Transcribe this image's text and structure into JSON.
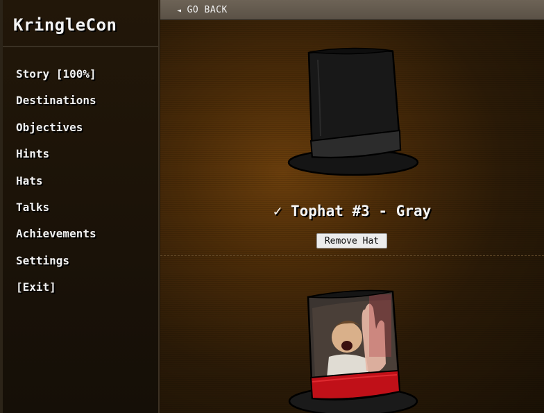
{
  "sidebar": {
    "logo": "KringleCon",
    "items": [
      {
        "label": "Story [100%]"
      },
      {
        "label": "Destinations"
      },
      {
        "label": "Objectives"
      },
      {
        "label": "Hints"
      },
      {
        "label": "Hats"
      },
      {
        "label": "Talks"
      },
      {
        "label": "Achievements"
      },
      {
        "label": "Settings"
      },
      {
        "label": "[Exit]"
      }
    ]
  },
  "header": {
    "back_arrow": "◄",
    "back_label": "GO BACK"
  },
  "hat": {
    "check": "✓",
    "title": "Tophat #3 - Gray",
    "remove_label": "Remove Hat",
    "icon": "tophat-gray-icon"
  },
  "next_hat": {
    "icon": "tophat-photo-icon",
    "band_color": "#c01018"
  }
}
